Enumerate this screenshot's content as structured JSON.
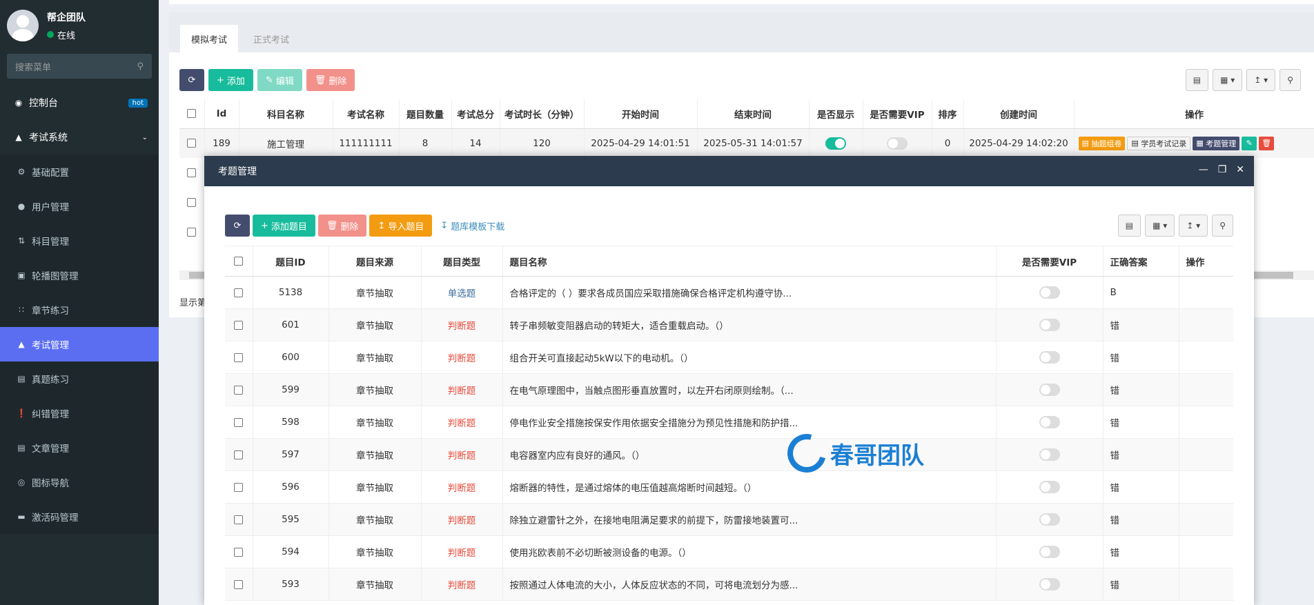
{
  "sidebar": {
    "user_name": "帮企团队",
    "user_status": "在线",
    "search_placeholder": "搜索菜单",
    "items": [
      {
        "label": "控制台",
        "badge": "hot"
      },
      {
        "label": "考试系统"
      },
      {
        "label": "基础配置"
      },
      {
        "label": "用户管理"
      },
      {
        "label": "科目管理"
      },
      {
        "label": "轮播图管理"
      },
      {
        "label": "章节练习"
      },
      {
        "label": "考试管理"
      },
      {
        "label": "真题练习"
      },
      {
        "label": "纠错管理"
      },
      {
        "label": "文章管理"
      },
      {
        "label": "图标导航"
      },
      {
        "label": "激活码管理"
      }
    ]
  },
  "tabs": [
    "模拟考试",
    "正式考试"
  ],
  "toolbar": {
    "add": "添加",
    "edit": "编辑",
    "delete": "删除"
  },
  "exam_table": {
    "headers": [
      "Id",
      "科目名称",
      "考试名称",
      "题目数量",
      "考试总分",
      "考试时长（分钟）",
      "开始时间",
      "结束时间",
      "是否显示",
      "是否需要VIP",
      "排序",
      "创建时间",
      "操作"
    ],
    "row": {
      "id": "189",
      "subject": "施工管理",
      "name": "111111111",
      "count": "8",
      "score": "14",
      "duration": "120",
      "start": "2025-04-29 14:01:51",
      "end": "2025-05-31 14:01:57",
      "sort": "0",
      "created": "2025-04-29 14:02:20"
    },
    "ops": {
      "draw": "抽题组卷",
      "record": "学员考试记录",
      "manage": "考题管理"
    },
    "footer_text": "显示第"
  },
  "modal": {
    "title": "考题管理",
    "toolbar": {
      "add": "添加题目",
      "delete": "删除",
      "import": "导入题目",
      "download": "题库模板下载"
    },
    "headers": [
      "题目ID",
      "题目来源",
      "题目类型",
      "题目名称",
      "是否需要VIP",
      "正确答案",
      "操作"
    ],
    "rows": [
      {
        "id": "5138",
        "source": "章节抽取",
        "type": "单选题",
        "name": "合格评定的（ ）要求各成员国应采取措施确保合格评定机构遵守协...",
        "answer": "B"
      },
      {
        "id": "601",
        "source": "章节抽取",
        "type": "判断题",
        "name": "转子串频敏变阻器启动的转矩大，适合重载启动。（）",
        "answer": "错"
      },
      {
        "id": "600",
        "source": "章节抽取",
        "type": "判断题",
        "name": "组合开关可直接起动5kW以下的电动机。（）",
        "answer": "错"
      },
      {
        "id": "599",
        "source": "章节抽取",
        "type": "判断题",
        "name": "在电气原理图中，当触点图形垂直放置时，以左开右闭原则绘制。（...",
        "answer": "错"
      },
      {
        "id": "598",
        "source": "章节抽取",
        "type": "判断题",
        "name": "停电作业安全措施按保安作用依据安全措施分为预见性措施和防护措...",
        "answer": "错"
      },
      {
        "id": "597",
        "source": "章节抽取",
        "type": "判断题",
        "name": "电容器室内应有良好的通风。（）",
        "answer": "错"
      },
      {
        "id": "596",
        "source": "章节抽取",
        "type": "判断题",
        "name": "熔断器的特性，是通过熔体的电压值越高熔断时间越短。（）",
        "answer": "错"
      },
      {
        "id": "595",
        "source": "章节抽取",
        "type": "判断题",
        "name": "除独立避雷针之外，在接地电阻满足要求的前提下，防雷接地装置可...",
        "answer": "错"
      },
      {
        "id": "594",
        "source": "章节抽取",
        "type": "判断题",
        "name": "使用兆欧表前不必切断被测设备的电源。（）",
        "answer": "错"
      },
      {
        "id": "593",
        "source": "章节抽取",
        "type": "判断题",
        "name": "按照通过人体电流的大小，人体反应状态的不同，可将电流划分为感...",
        "answer": "错"
      }
    ]
  },
  "watermark": "春哥团队",
  "colors": {
    "sidebar": "#222d32",
    "accent": "#5b6ef2",
    "green": "#18bc9c",
    "orange": "#f39c12",
    "red": "#e74c3c"
  }
}
